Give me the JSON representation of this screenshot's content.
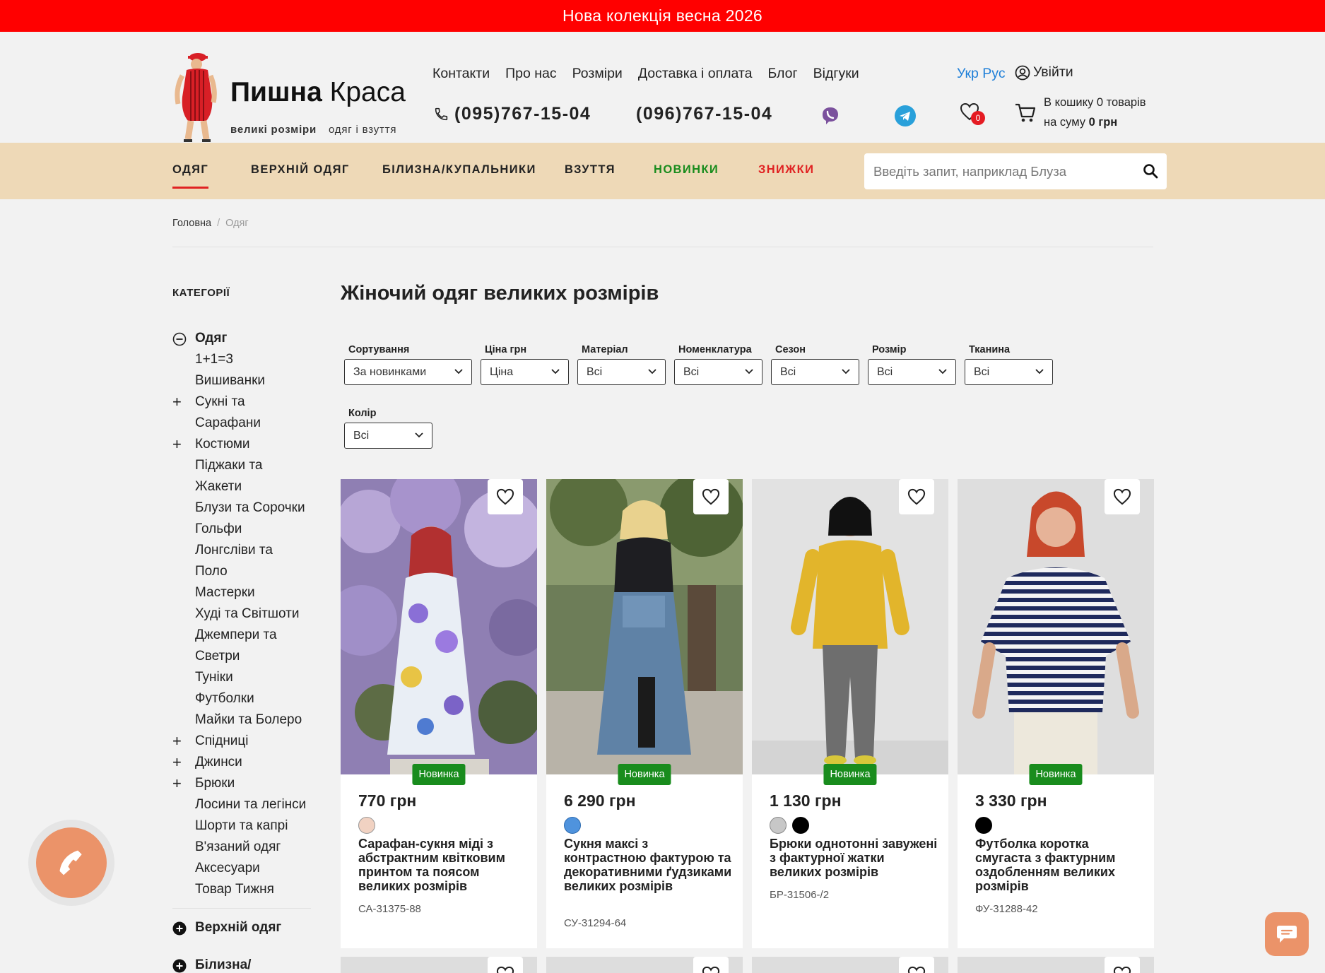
{
  "promo": "Нова колекція весна 2026",
  "logo": {
    "name_bold": "Пишна",
    "name_light": "Краса",
    "sub_bold": "великі розміри",
    "sub_light": "одяг і взуття"
  },
  "topnav": [
    "Контакти",
    "Про нас",
    "Розміри",
    "Доставка і оплата",
    "Блог",
    "Відгуки"
  ],
  "lang": "Укр Рус",
  "login": "Увійти",
  "phones": [
    "(095)767-15-04",
    "(096)767-15-04"
  ],
  "wishlist_count": "0",
  "cart": {
    "line1": "В кошику 0 товарів",
    "line2_prefix": "на суму ",
    "line2_sum": "0 грн"
  },
  "categories": [
    "ОДЯГ",
    "ВЕРХНІЙ ОДЯГ",
    "БІЛИЗНА/КУПАЛЬНИКИ",
    "ВЗУТТЯ",
    "НОВИНКИ",
    "ЗНИЖКИ"
  ],
  "search": {
    "placeholder": "Введіть запит, наприклад Блуза"
  },
  "breadcrumb": {
    "home": "Головна",
    "current": "Одяг"
  },
  "sidebar": {
    "title": "КАТЕГОРІЇ",
    "main": "Одяг",
    "items": [
      "1+1=3",
      "Вишиванки",
      "Сукні та",
      "Сарафани",
      "Костюми",
      "Піджаки та",
      "Жакети",
      "Блузи та Сорочки",
      "Гольфи",
      "Лонгсліви та",
      "Поло",
      "Мастерки",
      "Худі та Світшоти",
      "Джемпери та",
      "Светри",
      "Туніки",
      "Футболки",
      "Майки та Болеро",
      "Спідниці",
      "Джинси",
      "Брюки",
      "Лосини та легінси",
      "Шорти та капрі",
      "В'язаний одяг",
      "Аксесуари",
      "Товар Тижня"
    ],
    "sub1": "Верхній одяг",
    "sub2": "Білизна/"
  },
  "page_title": "Жіночий одяг великих розмірів",
  "filters": [
    {
      "label": "Сортування",
      "value": "За новинками"
    },
    {
      "label": "Ціна  грн",
      "value": "Ціна"
    },
    {
      "label": "Матеріал",
      "value": "Всі"
    },
    {
      "label": "Номенклатура",
      "value": "Всі"
    },
    {
      "label": "Сезон",
      "value": "Всі"
    },
    {
      "label": "Розмір",
      "value": "Всі"
    },
    {
      "label": "Тканина",
      "value": "Всі"
    },
    {
      "label": "Колір",
      "value": "Всі"
    }
  ],
  "products": [
    {
      "badge": "Новинка",
      "price": "770 грн",
      "name": "Сарафан-сукня міді з абстрактним квітковим принтом та поясом великих розмірів",
      "sku": "СА-31375-88",
      "swatches": [
        "#f1d2c2"
      ]
    },
    {
      "badge": "Новинка",
      "price": "6 290 грн",
      "name": "Сукня максі з контрастною фактурою та декоративними ґудзиками великих розмірів",
      "sku": "СУ-31294-64",
      "swatches": [
        "#4f93dd"
      ]
    },
    {
      "badge": "Новинка",
      "price": "1 130 грн",
      "name": "Брюки однотонні завужені з фактурної жатки великих розмірів",
      "sku": "БР-31506-/2",
      "swatches": [
        "#c7c7c7",
        "#000000"
      ]
    },
    {
      "badge": "Новинка",
      "price": "3 330 грн",
      "name": "Футболка коротка смугаста з фактурним оздобленням великих розмірів",
      "sku": "ФУ-31288-42",
      "swatches": [
        "#000000"
      ]
    }
  ],
  "colors": {
    "promo": "#ff0000",
    "catbar": "#eed9b7",
    "new": "#198c1d",
    "sale": "#e02222",
    "accent": "#eb9369",
    "lang": "#1e7fd8"
  }
}
